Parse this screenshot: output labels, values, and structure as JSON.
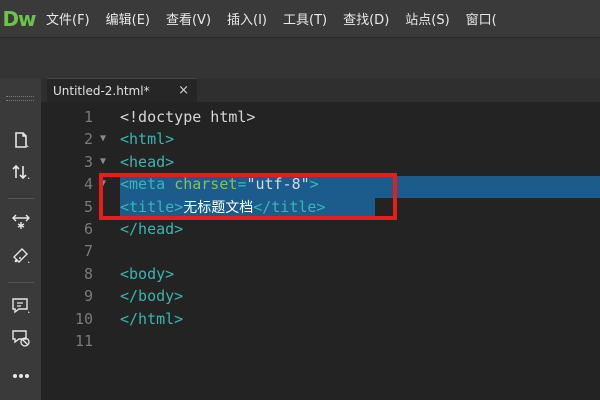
{
  "app": {
    "logo": "Dw"
  },
  "menu": [
    {
      "label": "文件(F)"
    },
    {
      "label": "编辑(E)"
    },
    {
      "label": "查看(V)"
    },
    {
      "label": "插入(I)"
    },
    {
      "label": "工具(T)"
    },
    {
      "label": "查找(D)"
    },
    {
      "label": "站点(S)"
    },
    {
      "label": "窗口("
    }
  ],
  "tab": {
    "title": "Untitled-2.html*",
    "close": "×"
  },
  "editor": {
    "lines": [
      {
        "num": "1",
        "fold": "",
        "parts": [
          [
            "plain",
            "<!doctype html>"
          ]
        ]
      },
      {
        "num": "2",
        "fold": "▼",
        "parts": [
          [
            "tag",
            "<html>"
          ]
        ]
      },
      {
        "num": "3",
        "fold": "▼",
        "parts": [
          [
            "tag",
            "<head>"
          ]
        ]
      },
      {
        "num": "4",
        "fold": "▼",
        "parts": [
          [
            "tag",
            "<meta "
          ],
          [
            "attr",
            "charset"
          ],
          [
            "tag",
            "="
          ],
          [
            "str",
            "\"utf-8\""
          ],
          [
            "tag",
            ">"
          ]
        ]
      },
      {
        "num": "5",
        "fold": "",
        "parts": [
          [
            "tag",
            "<title>"
          ],
          [
            "cn",
            "无标题文档"
          ],
          [
            "tag",
            "</title>"
          ]
        ]
      },
      {
        "num": "6",
        "fold": "",
        "parts": [
          [
            "tag",
            "</head>"
          ]
        ]
      },
      {
        "num": "7",
        "fold": "",
        "parts": []
      },
      {
        "num": "8",
        "fold": "",
        "parts": [
          [
            "tag",
            "<body>"
          ]
        ]
      },
      {
        "num": "9",
        "fold": "",
        "parts": [
          [
            "tag",
            "</body>"
          ]
        ]
      },
      {
        "num": "10",
        "fold": "",
        "parts": [
          [
            "tag",
            "</html>"
          ]
        ]
      },
      {
        "num": "11",
        "fold": "",
        "parts": []
      }
    ]
  },
  "tools": [
    {
      "icon": "new-document-icon"
    },
    {
      "icon": "sort-arrows-icon"
    },
    {
      "icon": "expand-collapse-icon"
    },
    {
      "icon": "wrap-tag-icon"
    },
    {
      "icon": "comment-icon"
    },
    {
      "icon": "remove-comment-icon"
    },
    {
      "icon": "more-icon"
    }
  ],
  "colors": {
    "selection": "#1c5c8c",
    "highlight_border": "#e81c1c",
    "tag": "#39b6b0",
    "attr": "#8fbc5a",
    "logo": "#6cc24a"
  }
}
